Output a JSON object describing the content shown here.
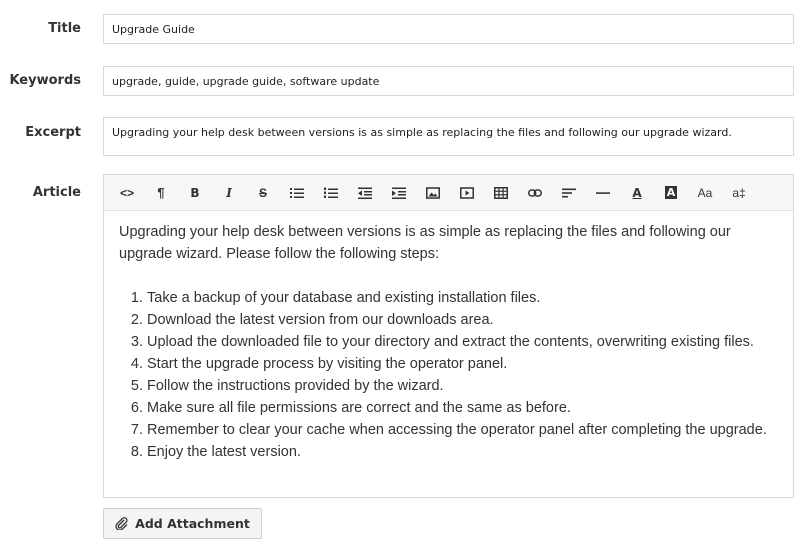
{
  "form": {
    "title_label": "Title",
    "title_value": "Upgrade Guide",
    "keywords_label": "Keywords",
    "keywords_value": "upgrade, guide, upgrade guide, software update",
    "excerpt_label": "Excerpt",
    "excerpt_value": "Upgrading your help desk between versions is as simple as replacing the files and following our upgrade wizard.",
    "article_label": "Article"
  },
  "toolbar": {
    "items": [
      {
        "name": "code-view",
        "glyph": "<>"
      },
      {
        "name": "paragraph",
        "glyph": "¶"
      },
      {
        "name": "bold",
        "glyph": "B"
      },
      {
        "name": "italic",
        "glyph": "I"
      },
      {
        "name": "strikethrough",
        "glyph": "S"
      },
      {
        "name": "unordered-list",
        "glyph": ""
      },
      {
        "name": "ordered-list",
        "glyph": ""
      },
      {
        "name": "outdent",
        "glyph": ""
      },
      {
        "name": "indent",
        "glyph": ""
      },
      {
        "name": "image",
        "glyph": ""
      },
      {
        "name": "video",
        "glyph": ""
      },
      {
        "name": "table",
        "glyph": ""
      },
      {
        "name": "link",
        "glyph": ""
      },
      {
        "name": "alignment",
        "glyph": ""
      },
      {
        "name": "horizontal-rule",
        "glyph": ""
      },
      {
        "name": "font-color",
        "glyph": "A"
      },
      {
        "name": "background-color",
        "glyph": "A"
      },
      {
        "name": "font-family",
        "glyph": "Aa"
      },
      {
        "name": "font-size",
        "glyph": "a‡"
      }
    ]
  },
  "article": {
    "intro": "Upgrading your help desk between versions is as simple as replacing the files and following our upgrade wizard. Please follow the following steps:",
    "steps": [
      "Take a backup of your database and existing installation files.",
      "Download the latest version from our downloads area.",
      "Upload the downloaded file to your directory and extract the contents, overwriting existing files.",
      "Start the upgrade process by visiting the operator panel.",
      "Follow the instructions provided by the wizard.",
      "Make sure all file permissions are correct and the same as before.",
      "Remember to clear your cache when accessing the operator panel after completing the upgrade.",
      "Enjoy the latest version."
    ]
  },
  "attachment": {
    "button_label": "Add Attachment"
  }
}
